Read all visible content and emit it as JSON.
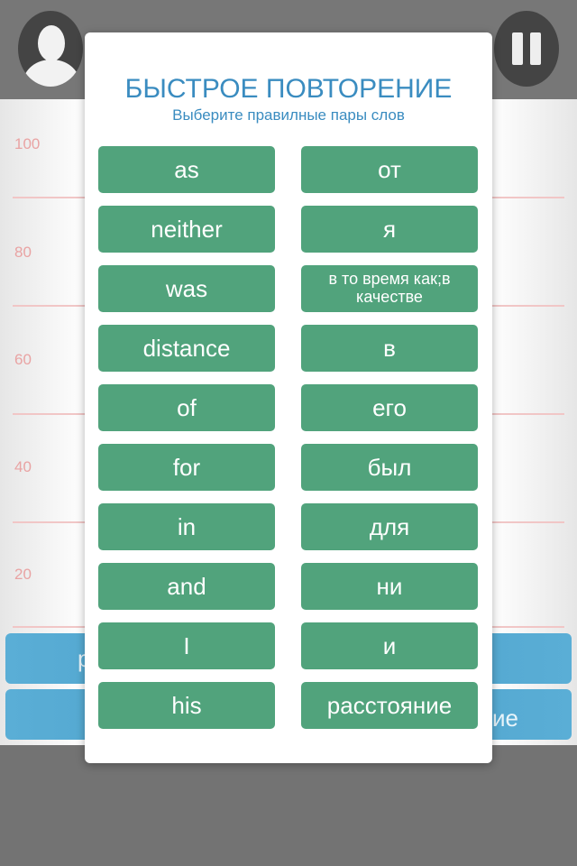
{
  "modal": {
    "title": "БЫСТРОЕ ПОВТОРЕНИЕ",
    "subtitle": "Выберите правилные пары слов"
  },
  "english": [
    "as",
    "neither",
    "was",
    "distance",
    "of",
    "for",
    "in",
    "and",
    "I",
    "his"
  ],
  "russian": [
    "от",
    "я",
    "в то время как;в качестве",
    "в",
    "его",
    "был",
    "для",
    "ни",
    "и",
    "расстояние"
  ],
  "chart": {
    "y_labels": [
      "100",
      "80",
      "60",
      "40",
      "20"
    ]
  },
  "background_buttons": [
    {
      "label_partial_left": "р"
    },
    {
      "label_partial_right": "ие"
    }
  ],
  "colors": {
    "accent": "#3a8cc0",
    "word_button": "#51a37c",
    "bg_button": "#52a8d2",
    "grid": "#f1c6c6"
  }
}
